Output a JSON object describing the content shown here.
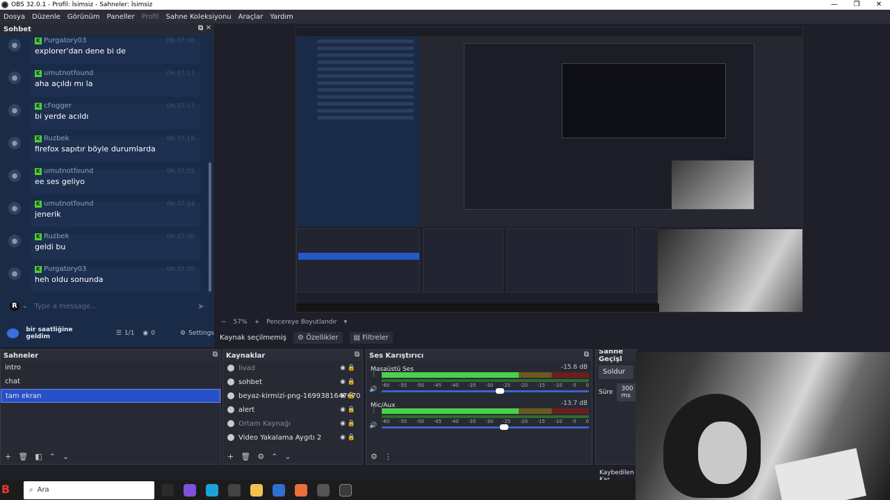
{
  "window": {
    "title": "OBS 32.0.1 - Profil: İsimsiz - Sahneler: İsimsiz"
  },
  "menu": [
    "Dosya",
    "Düzenle",
    "Görünüm",
    "Paneller",
    "Profil",
    "Sahne Koleksiyonu",
    "Araçlar",
    "Yardım"
  ],
  "chat": {
    "title": "Sohbet",
    "messages": [
      {
        "user": "Purgatory03",
        "time": "06:37:16",
        "text": "explorer'dan dene bi de"
      },
      {
        "user": "umutnotfound",
        "time": "06:37:17",
        "text": "aha açıldı mı la"
      },
      {
        "user": "cFogger",
        "time": "06:37:17",
        "text": "bi yerde acıldı"
      },
      {
        "user": "Ruzbek",
        "time": "06:37:19",
        "text": "firefox sapıtır böyle durumlarda"
      },
      {
        "user": "umutnotfound",
        "time": "06:37:22",
        "text": "ee ses geliyo"
      },
      {
        "user": "umutnotfound",
        "time": "06:37:24",
        "text": "jenerik"
      },
      {
        "user": "Ruzbek",
        "time": "06:37:30",
        "text": "geldi bu"
      },
      {
        "user": "Purgatory03",
        "time": "06:37:30",
        "text": "heh oldu sonunda"
      }
    ],
    "input_badge": "R",
    "input_placeholder": "Type a message...",
    "channel_name": "bir saatliğine geldim",
    "count": "1/1",
    "viewers": "0",
    "settings": "Settings"
  },
  "preview": {
    "zoom": "57%",
    "fit_label": "Pencereye Boyutlandır"
  },
  "propbar": {
    "no_source": "Kaynak seçilmemiş",
    "properties": "Özellikler",
    "filters": "Filtreler"
  },
  "scenes": {
    "title": "Sahneler",
    "items": [
      "intro",
      "chat",
      "tam ekran"
    ],
    "active_index": 2
  },
  "sources": {
    "title": "Kaynaklar",
    "items": [
      {
        "name": "livad",
        "dim": true
      },
      {
        "name": "sohbet",
        "dim": false
      },
      {
        "name": "beyaz-kirmizi-png-1699381647670",
        "dim": false
      },
      {
        "name": "alert",
        "dim": false
      },
      {
        "name": "Ortam Kaynağı",
        "dim": true
      },
      {
        "name": "Video Yakalama Aygıtı 2",
        "dim": false
      }
    ]
  },
  "mixer": {
    "title": "Ses Karıştırıcı",
    "channels": [
      {
        "name": "Masaüstü Ses",
        "db": "-15.6 dB",
        "level": 0.66,
        "volume": 0.55
      },
      {
        "name": "Mic/Aux",
        "db": "-13.7 dB",
        "level": 0.66,
        "volume": 0.57
      }
    ],
    "scale": [
      "-60",
      "-55",
      "-50",
      "-45",
      "-40",
      "-35",
      "-30",
      "-25",
      "-20",
      "-15",
      "-10",
      "-5",
      "0"
    ]
  },
  "transitions": {
    "title": "Sahne Geçişl",
    "selected": "Soldur",
    "duration_label": "Süre",
    "duration": "300 ms"
  },
  "status": {
    "dropped": "Kaybedilen Kar"
  },
  "taskbar": {
    "search": "Ara"
  },
  "colors": {
    "accent": "#2850c8",
    "chat_bg": "#1a2b48",
    "kick_green": "#52d22a"
  }
}
